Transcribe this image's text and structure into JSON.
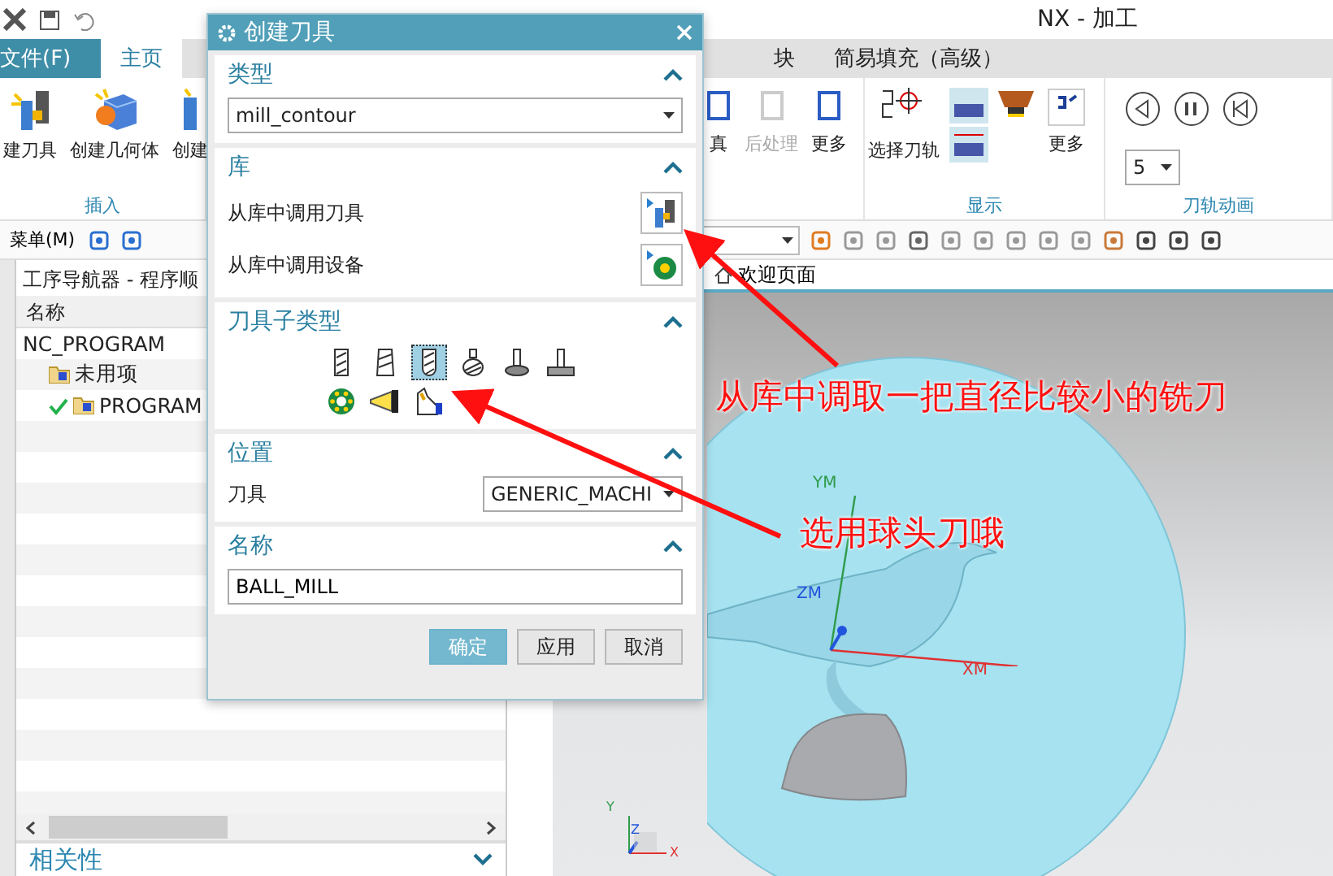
{
  "window": {
    "title": "NX - 加工"
  },
  "ribbon_tabs": [
    {
      "label": "文件(F)",
      "kind": "file",
      "selected": false
    },
    {
      "label": "主页",
      "kind": "tab",
      "selected": true
    },
    {
      "label": "块",
      "kind": "tab",
      "selected": false
    },
    {
      "label": "简易填充（高级）",
      "kind": "tab",
      "selected": false
    }
  ],
  "insert_group": {
    "label": "插入",
    "buttons": [
      {
        "label": "建刀具",
        "kind": "tool"
      },
      {
        "label": "创建几何体",
        "kind": "geometry"
      },
      {
        "label": "创建",
        "kind": "operation"
      }
    ]
  },
  "output_group": {
    "buttons": [
      {
        "label": "真",
        "disabled": false
      },
      {
        "label": "后处理",
        "disabled": true
      },
      {
        "label": "更多",
        "disabled": false
      }
    ]
  },
  "display_group": {
    "label": "显示",
    "buttons": [
      {
        "label": "选择刀轨"
      },
      {
        "label": "更多"
      }
    ]
  },
  "animation_group": {
    "label": "刀轨动画",
    "speed": "5"
  },
  "command_bar": {
    "menu": "菜单(M)"
  },
  "navigator": {
    "title": "工序导航器 - 程序顺",
    "column": "名称",
    "tree": [
      {
        "label": "NC_PROGRAM",
        "checked": false,
        "children": [
          {
            "label": "未用项",
            "checked": false
          },
          {
            "label": "PROGRAM",
            "checked": true
          }
        ]
      }
    ],
    "footer": {
      "label": "相关性",
      "expanded": false
    }
  },
  "viewport": {
    "tab": "欢迎页面",
    "axes": [
      {
        "label": "YM",
        "color": "#2e9b4a"
      },
      {
        "label": "ZM",
        "color": "#2255dd"
      },
      {
        "label": "XM",
        "color": "#e03030"
      }
    ],
    "triad": [
      {
        "label": "Y",
        "color": "#2e9b4a"
      },
      {
        "label": "Z",
        "color": "#2255dd"
      },
      {
        "label": "X",
        "color": "#e03030"
      }
    ]
  },
  "annotations": [
    {
      "text": "从库中调取一把直径比较小的铣刀"
    },
    {
      "text": "选用球头刀哦"
    }
  ],
  "dialog": {
    "title": "创建刀具",
    "type_section": {
      "heading": "类型",
      "expanded": true,
      "value": "mill_contour"
    },
    "library_section": {
      "heading": "库",
      "expanded": true,
      "items": [
        {
          "label": "从库中调用刀具",
          "kind": "tool"
        },
        {
          "label": "从库中调用设备",
          "kind": "device"
        }
      ]
    },
    "subtype_section": {
      "heading": "刀具子类型",
      "expanded": true,
      "tools": [
        {
          "kind": "end-mill",
          "selected": false
        },
        {
          "kind": "taper-mill",
          "selected": false
        },
        {
          "kind": "ball-mill",
          "selected": true
        },
        {
          "kind": "barrel",
          "selected": false
        },
        {
          "kind": "t-cutter",
          "selected": false
        },
        {
          "kind": "t-slot",
          "selected": false
        },
        {
          "kind": "gear",
          "selected": false
        },
        {
          "kind": "lamp",
          "selected": false
        },
        {
          "kind": "probe",
          "selected": false
        }
      ]
    },
    "location_section": {
      "heading": "位置",
      "expanded": true,
      "label": "刀具",
      "value": "GENERIC_MACHI"
    },
    "name_section": {
      "heading": "名称",
      "expanded": true,
      "value": "BALL_MILL"
    },
    "buttons": [
      {
        "label": "确定",
        "kind": "primary"
      },
      {
        "label": "应用",
        "kind": "normal"
      },
      {
        "label": "取消",
        "kind": "normal"
      }
    ]
  }
}
